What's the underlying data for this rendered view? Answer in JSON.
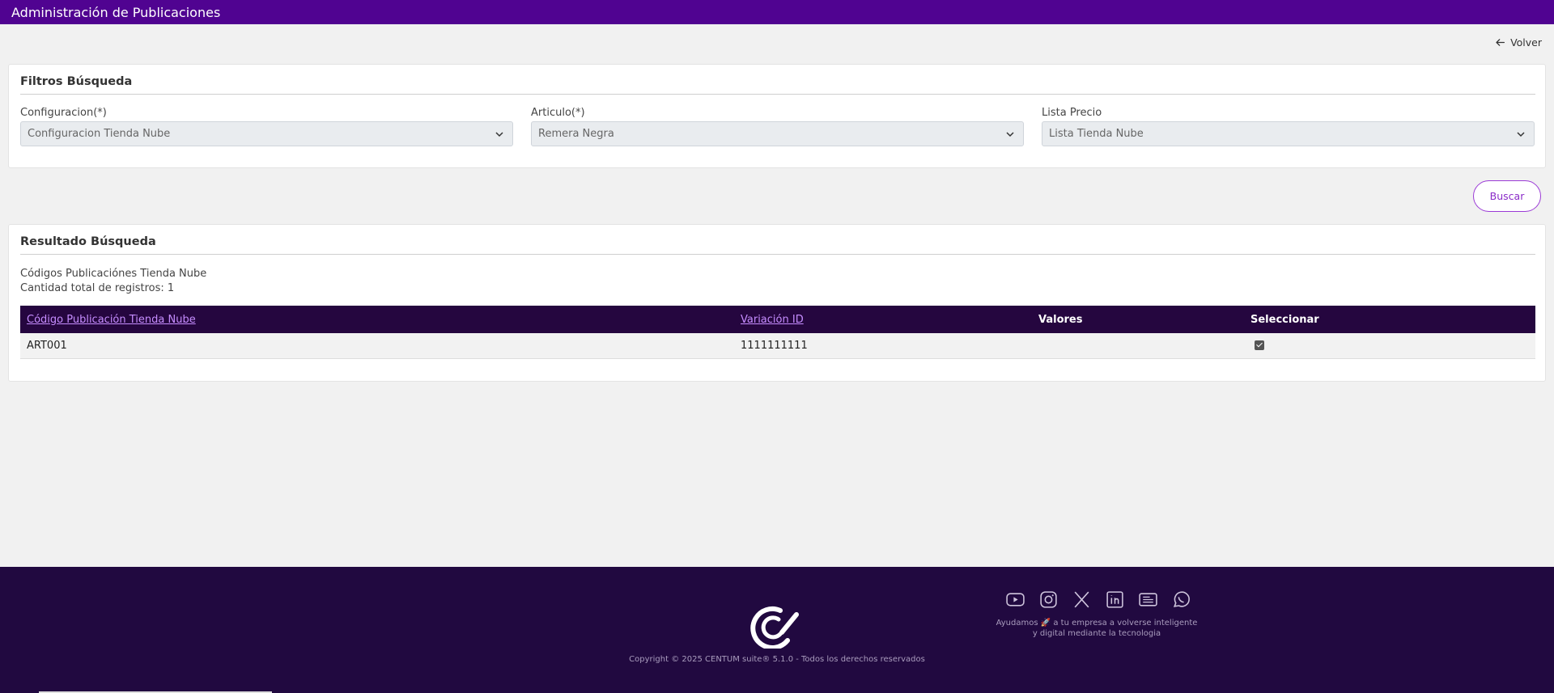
{
  "header": {
    "title": "Administración de Publicaciones"
  },
  "nav": {
    "back_label": "Volver"
  },
  "filters": {
    "title": "Filtros Búsqueda",
    "fields": [
      {
        "label": "Configuracion(*)",
        "value": "Configuracion Tienda Nube"
      },
      {
        "label": "Articulo(*)",
        "value": "Remera Negra"
      },
      {
        "label": "Lista Precio",
        "value": "Lista Tienda Nube"
      }
    ],
    "search_button": "Buscar"
  },
  "results": {
    "title": "Resultado Búsqueda",
    "subtitle": "Códigos Publicaciónes Tienda Nube",
    "count_text": "Cantidad total de registros: 1",
    "columns": [
      "Código Publicación Tienda Nube",
      "Variación ID",
      "Valores",
      "Seleccionar"
    ],
    "rows": [
      {
        "codigo": "ART001",
        "variacion": "1111111111",
        "valores": "",
        "selected": true
      }
    ]
  },
  "footer": {
    "copyright": "Copyright © 2025 CENTUM suite® 5.1.0 - Todos los derechos reservados",
    "tagline_line1": "Ayudamos 🚀 a tu empresa a volverse inteligente",
    "tagline_line2": "y digital mediante la tecnologia",
    "socials": [
      "youtube-icon",
      "instagram-icon",
      "x-icon",
      "linkedin-icon",
      "news-icon",
      "whatsapp-icon"
    ],
    "colors": {
      "brand": "#500391",
      "footer_bg": "#210940",
      "table_header": "#25063f",
      "accent": "#8a2bc8"
    }
  }
}
